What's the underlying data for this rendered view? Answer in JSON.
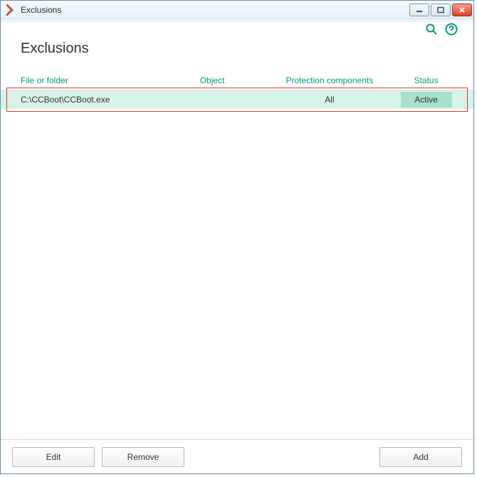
{
  "window": {
    "title": "Exclusions"
  },
  "page": {
    "heading": "Exclusions"
  },
  "columns": {
    "file": "File or folder",
    "object": "Object",
    "protection": "Protection components",
    "status": "Status"
  },
  "rows": [
    {
      "file": "C:\\CCBoot\\CCBoot.exe",
      "object": "",
      "protection": "All",
      "status": "Active"
    }
  ],
  "buttons": {
    "edit": "Edit",
    "remove": "Remove",
    "add": "Add"
  },
  "colors": {
    "accent": "#009a78",
    "row_highlight": "#d8f3ea",
    "status_pill": "#a9e0cc",
    "annotation_red": "#d8392a"
  }
}
